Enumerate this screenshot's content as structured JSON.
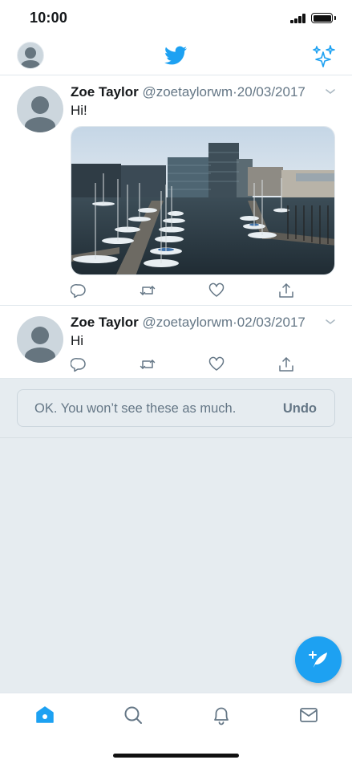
{
  "status_bar": {
    "time": "10:00"
  },
  "colors": {
    "accent": "#1da1f2",
    "secondary_text": "#657786",
    "feedback_bg": "#e6ecf0"
  },
  "top_nav": {
    "avatar_icon": "profile-avatar",
    "logo_icon": "twitter-bird-icon",
    "right_icon": "sparkle-icon"
  },
  "tweets": [
    {
      "name": "Zoe Taylor",
      "handle": "@zoetaylorwm",
      "separator": "·",
      "date": "20/03/2017",
      "text": "Hi!",
      "has_media": true,
      "media_icon": "harbor-photo"
    },
    {
      "name": "Zoe Taylor",
      "handle": "@zoetaylorwm",
      "separator": "·",
      "date": "02/03/2017",
      "text": "Hi",
      "has_media": false
    }
  ],
  "tweet_actions": [
    "reply-icon",
    "retweet-icon",
    "like-icon",
    "share-icon"
  ],
  "feedback": {
    "message": "OK. You won’t see these as much.",
    "undo_label": "Undo"
  },
  "compose": {
    "icon": "compose-tweet-icon"
  },
  "tab_bar": {
    "tabs": [
      "home-icon",
      "search-icon",
      "notifications-icon",
      "messages-icon"
    ],
    "active": "home-icon"
  }
}
